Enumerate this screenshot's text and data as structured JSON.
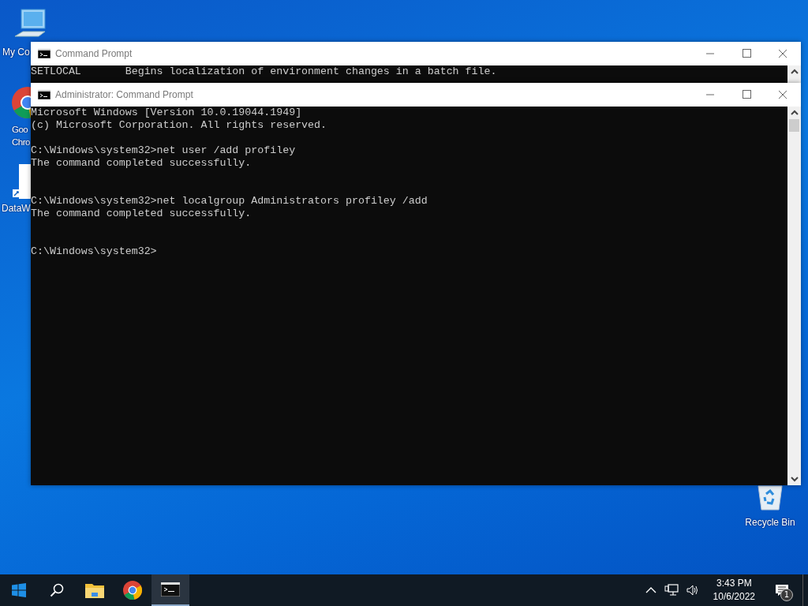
{
  "desktop_icons": [
    {
      "kind": "computer",
      "label_lines": [
        "My Co"
      ]
    },
    {
      "kind": "chrome",
      "label_lines": [
        "Goo",
        "Chro"
      ]
    },
    {
      "kind": "document",
      "label_lines": [
        "DataW"
      ]
    },
    {
      "kind": "recycle",
      "label_lines": [
        "Recycle Bin"
      ]
    }
  ],
  "windows": [
    {
      "title": "Command Prompt",
      "console": [
        {
          "kind": "text",
          "line": "SETLOCAL       Begins localization of environment changes in a batch file."
        }
      ]
    },
    {
      "title": "Administrator: Command Prompt",
      "console": [
        {
          "kind": "banner",
          "lines": [
            "Microsoft Windows [Version 10.0.19044.1949]",
            "(c) Microsoft Corporation. All rights reserved."
          ]
        },
        {
          "kind": "command",
          "line": "C:\\Windows\\system32>net user /add profiley",
          "output": "The command completed successfully."
        },
        {
          "kind": "command",
          "line": "C:\\Windows\\system32>net localgroup Administrators profiley /add",
          "output": "The command completed successfully."
        },
        {
          "kind": "prompt",
          "line": "C:\\Windows\\system32>"
        }
      ]
    }
  ],
  "taskbar": {
    "apps": [
      {
        "kind": "start",
        "selected": false
      },
      {
        "kind": "search",
        "selected": false
      },
      {
        "kind": "explorer",
        "selected": false
      },
      {
        "kind": "chrome",
        "selected": false
      },
      {
        "kind": "console",
        "selected": true
      }
    ],
    "clock": {
      "time": "3:43 PM",
      "date": "10/6/2022"
    },
    "notifications": {
      "count": "1"
    }
  }
}
